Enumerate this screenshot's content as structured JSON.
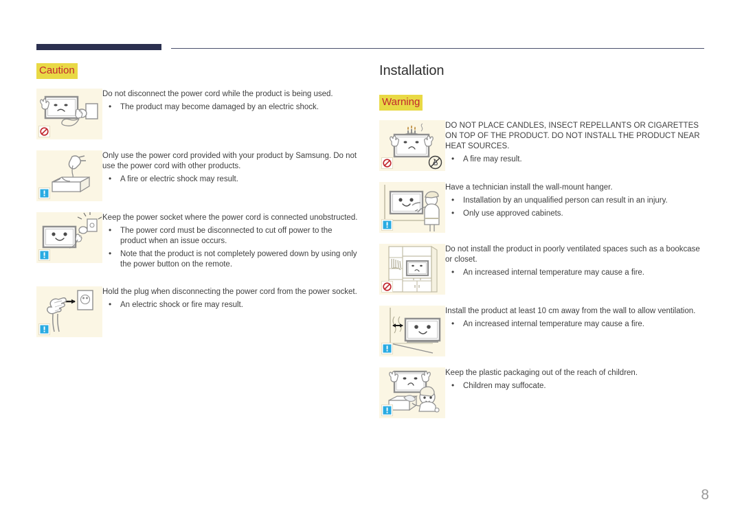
{
  "colors": {
    "rule_dark": "#2b3050",
    "alert_bg": "#e9d945",
    "alert_fg": "#c1272d",
    "figure_bg": "#fbf6e4",
    "body_text": "#3f3f3f",
    "page_number": "#9a9a9a"
  },
  "page_number": "8",
  "left_column": {
    "alert_label": "Caution",
    "items": [
      {
        "figure_name": "monitor-unplugging-cord-prohibited",
        "badge": "prohibit",
        "lead": "Do not disconnect the power cord while the product is being used.",
        "bullets": [
          "The product may become damaged by an electric shock."
        ]
      },
      {
        "figure_name": "power-cord-in-box-notice",
        "badge": "notice",
        "lead": "Only use the power cord provided with your product by Samsung. Do not use the power cord with other products.",
        "bullets": [
          "A fire or electric shock may result."
        ]
      },
      {
        "figure_name": "monitor-socket-accessible-notice",
        "badge": "notice",
        "lead": "Keep the power socket where the power cord is connected unobstructed.",
        "bullets": [
          "The power cord must be disconnected to cut off power to the product when an issue occurs.",
          "Note that the product is not completely powered down by using only the power button on the remote."
        ]
      },
      {
        "figure_name": "hand-holding-plug-notice",
        "badge": "notice",
        "lead": "Hold the plug when disconnecting the power cord from the power socket.",
        "bullets": [
          "An electric shock or fire may result."
        ]
      }
    ]
  },
  "right_column": {
    "section_title": "Installation",
    "alert_label": "Warning",
    "items": [
      {
        "figure_name": "candles-on-product-prohibited",
        "badge": "prohibit",
        "extra_badge": "no-flame-circle",
        "lead": "DO NOT PLACE CANDLES, INSECT REPELLANTS OR CIGARETTES ON TOP OF THE PRODUCT. DO NOT INSTALL THE PRODUCT NEAR HEAT SOURCES.",
        "bullets": [
          "A fire may result."
        ]
      },
      {
        "figure_name": "technician-wall-mount-notice",
        "badge": "notice",
        "lead": "Have a technician install the wall-mount hanger.",
        "bullets": [
          "Installation by an unqualified person can result in an injury.",
          "Only use approved cabinets."
        ]
      },
      {
        "figure_name": "product-in-bookcase-prohibited",
        "badge": "prohibit",
        "lead": "Do not install the product in poorly ventilated spaces such as a bookcase or closet.",
        "bullets": [
          "An increased internal temperature may cause a fire."
        ]
      },
      {
        "figure_name": "product-distance-from-wall-notice",
        "badge": "notice",
        "lead": "Install the product at least 10 cm away from the wall to allow ventilation.",
        "bullets": [
          "An increased internal temperature may cause a fire."
        ]
      },
      {
        "figure_name": "child-with-plastic-packaging-notice",
        "badge": "notice",
        "lead": "Keep the plastic packaging out of the reach of children.",
        "bullets": [
          "Children may suffocate."
        ]
      }
    ]
  }
}
